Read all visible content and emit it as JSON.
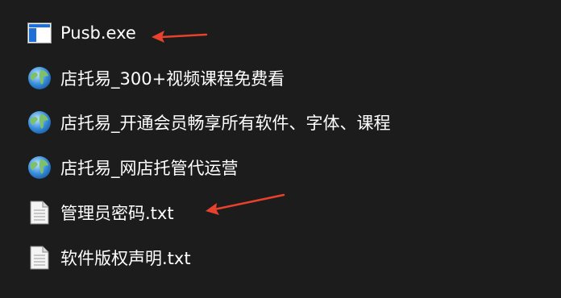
{
  "files": [
    {
      "name": "Pusb.exe",
      "icon": "exe-window-icon"
    },
    {
      "name": "店托易_300+视频课程免费看",
      "icon": "globe-icon"
    },
    {
      "name": "店托易_开通会员畅享所有软件、字体、课程",
      "icon": "globe-icon"
    },
    {
      "name": "店托易_网店托管代运营",
      "icon": "globe-icon"
    },
    {
      "name": "管理员密码.txt",
      "icon": "text-file-icon"
    },
    {
      "name": "软件版权声明.txt",
      "icon": "text-file-icon"
    }
  ],
  "colors": {
    "background": "#1c1c1c",
    "text": "#ffffff",
    "arrow": "#e8412c",
    "exe_blue": "#1f6fd6"
  }
}
